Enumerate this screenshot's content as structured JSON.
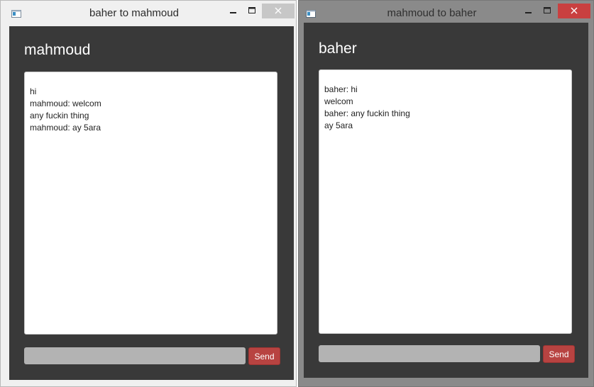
{
  "window1": {
    "title": "baher to mahmoud",
    "peer_name": "mahmoud",
    "messages": [
      "hi",
      "mahmoud: welcom",
      "any fuckin thing",
      "mahmoud: ay 5ara"
    ],
    "input_value": "",
    "send_label": "Send",
    "icons": {
      "app": "app-window-icon",
      "minimize": "minimize-icon",
      "maximize": "maximize-icon",
      "close": "close-icon"
    }
  },
  "window2": {
    "title": "mahmoud to baher",
    "peer_name": "baher",
    "messages": [
      "baher: hi",
      "welcom",
      "baher: any fuckin thing",
      "ay 5ara"
    ],
    "input_value": "",
    "send_label": "Send",
    "icons": {
      "app": "app-window-icon",
      "minimize": "minimize-icon",
      "maximize": "maximize-icon",
      "close": "close-icon"
    }
  },
  "colors": {
    "client_bg": "#393939",
    "send_button": "#b84341",
    "inactive_titlebar": "#8a8a8a",
    "active_close": "#c94040"
  }
}
